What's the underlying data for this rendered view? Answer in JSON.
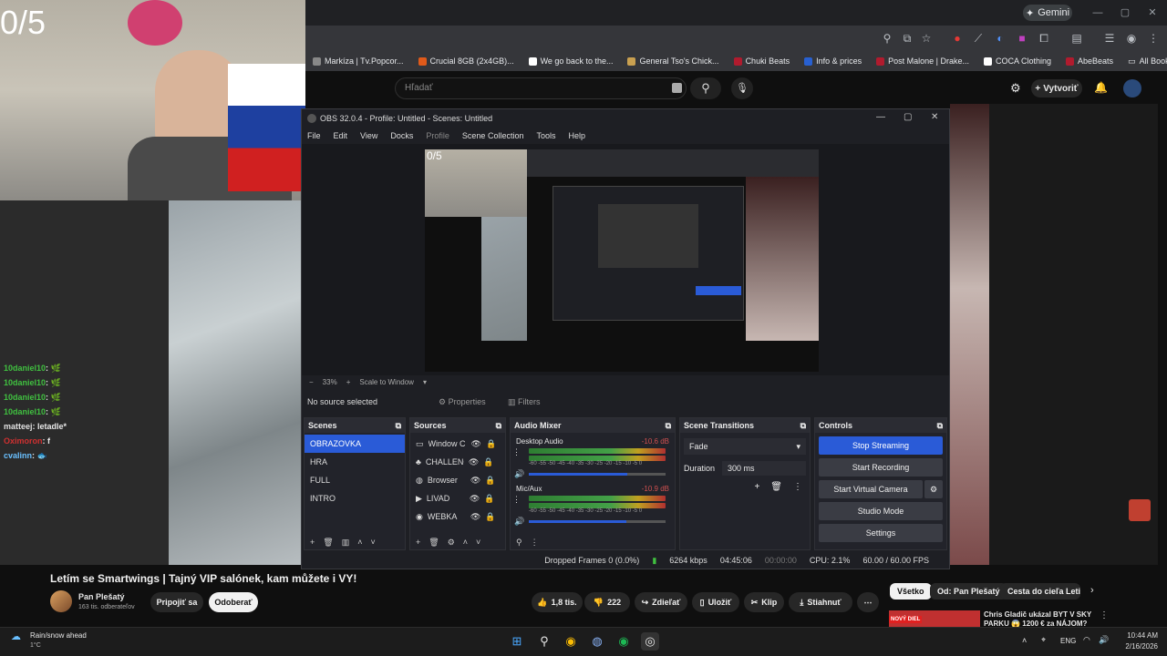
{
  "overlay": {
    "counter": "0/5"
  },
  "browser": {
    "gemini_label": "Gemini",
    "bookmarks": [
      {
        "label": "Markíza | Tv.Popcor...",
        "color": "#888888"
      },
      {
        "label": "Crucial 8GB (2x4GB)...",
        "color": "#e05a1a"
      },
      {
        "label": "We go back to the...",
        "color": "#ffffff"
      },
      {
        "label": "General Tso's Chick...",
        "color": "#c9a050"
      },
      {
        "label": "Chuki Beats",
        "color": "#b01b2e"
      },
      {
        "label": "Info & prices",
        "color": "#2860d0"
      },
      {
        "label": "Post Malone | Drake...",
        "color": "#b01b2e"
      },
      {
        "label": "COCA Clothing",
        "color": "#ffffff"
      },
      {
        "label": "AbeBeats",
        "color": "#b01b2e"
      }
    ],
    "all_bookmarks": "All Bookmarks"
  },
  "youtube": {
    "search_placeholder": "Hľadať",
    "create_label": "Vytvoriť",
    "video_title": "Letím se Smartwings | Tajný VIP salónek, kam můžete i VY!",
    "channel_name": "Pan Plešatý",
    "subscriber_count": "163 tis. odberateľov",
    "join_label": "Pripojiť sa",
    "subscribe_label": "Odoberať",
    "like_count": "1,8 tis.",
    "dislike_count": "222",
    "share_label": "Zdieľať",
    "save_label": "Uložiť",
    "clip_label": "Klip",
    "download_label": "Stiahnuť",
    "chips": [
      "Všetko",
      "Od: Pan Plešatý",
      "Cesta do cieľa Letis"
    ],
    "rec_title_line1": "Chris Gladič ukázal BYT V SKY",
    "rec_title_line2": "PARKU 😱 1200 € za NÁJOM?",
    "rec_badge": "NOVÝ DIEL"
  },
  "chat": [
    {
      "user": "10daniel10",
      "msg": ": 🌿",
      "color": "#40c040"
    },
    {
      "user": "10daniel10",
      "msg": ": 🌿",
      "color": "#40c040"
    },
    {
      "user": "10daniel10",
      "msg": ": 🌿",
      "color": "#40c040"
    },
    {
      "user": "10daniel10",
      "msg": ": 🌿",
      "color": "#40c040"
    },
    {
      "user": "matteej",
      "msg": ": letadle*",
      "color": "#e0e0e0"
    },
    {
      "user": "Oximoron",
      "msg": ": f",
      "color": "#d03030"
    },
    {
      "user": "cvalinn",
      "msg": ": 🐟",
      "color": "#6ac0ff"
    }
  ],
  "obs": {
    "title": "OBS 32.0.4 - Profile: Untitled - Scenes: Untitled",
    "menu": [
      "File",
      "Edit",
      "View",
      "Docks",
      "Profile",
      "Scene Collection",
      "Tools",
      "Help"
    ],
    "zoom": "33%",
    "scale_mode": "Scale to Window",
    "no_source": "No source selected",
    "properties_label": "Properties",
    "filters_label": "Filters",
    "scenes_header": "Scenes",
    "scenes": [
      "OBRAZOVKA",
      "HRA",
      "FULL",
      "INTRO"
    ],
    "sources_header": "Sources",
    "sources": [
      "Window C",
      "CHALLENG",
      "Browser",
      "LIVAD",
      "WEBKA"
    ],
    "mixer_header": "Audio Mixer",
    "mixer": [
      {
        "name": "Desktop Audio",
        "db": "-10.6 dB",
        "level": 0.72
      },
      {
        "name": "Mic/Aux",
        "db": "-10.9 dB",
        "level": 0.71
      }
    ],
    "meter_scale": "-60 -55 -50 -45 -40 -35 -30 -25 -20 -15 -10 -5 0",
    "transitions_header": "Scene Transitions",
    "transition": "Fade",
    "duration_label": "Duration",
    "duration_value": "300 ms",
    "controls_header": "Controls",
    "controls": [
      "Stop Streaming",
      "Start Recording",
      "Start Virtual Camera",
      "Studio Mode",
      "Settings"
    ],
    "status": {
      "dropped": "Dropped Frames 0 (0.0%)",
      "kbps": "6264 kbps",
      "live_time": "04:45:06",
      "rec_time": "00:00:00",
      "cpu": "CPU: 2.1%",
      "fps": "60.00 / 60.00 FPS"
    }
  },
  "taskbar": {
    "weather_title": "Rain/snow ahead",
    "weather_temp": "1°C",
    "lang": "ENG",
    "time": "10:44 AM",
    "date": "2/16/2026"
  }
}
